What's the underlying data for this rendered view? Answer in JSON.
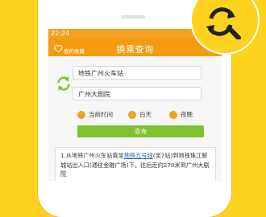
{
  "status_bar": {
    "time": "22:24"
  },
  "header": {
    "fav_label": "我的收藏",
    "title": "换乘查询"
  },
  "form": {
    "origin_value": "地铁广州火车站",
    "destination_value": "广州大剧院",
    "time_options": [
      {
        "label": "当前时间"
      },
      {
        "label": "白天"
      },
      {
        "label": "夜晚"
      }
    ],
    "query_label": "查询"
  },
  "result": {
    "seg1": "1.从地铁广州火车站乘坐",
    "line": "地铁五号线",
    "seg2": "(坐7站)到地铁珠江新城站出入口(通往金融广场)下。往后走约270米到广州大剧院"
  },
  "colors": {
    "background": "#ffd21f",
    "header": "#f39c11",
    "accent": "#f3a11f",
    "query_button": "#7dc32f",
    "swap_icon": "#7dc32f"
  },
  "icons": [
    "heart-icon",
    "share-icon",
    "swap-icon",
    "search-logo-icon"
  ]
}
